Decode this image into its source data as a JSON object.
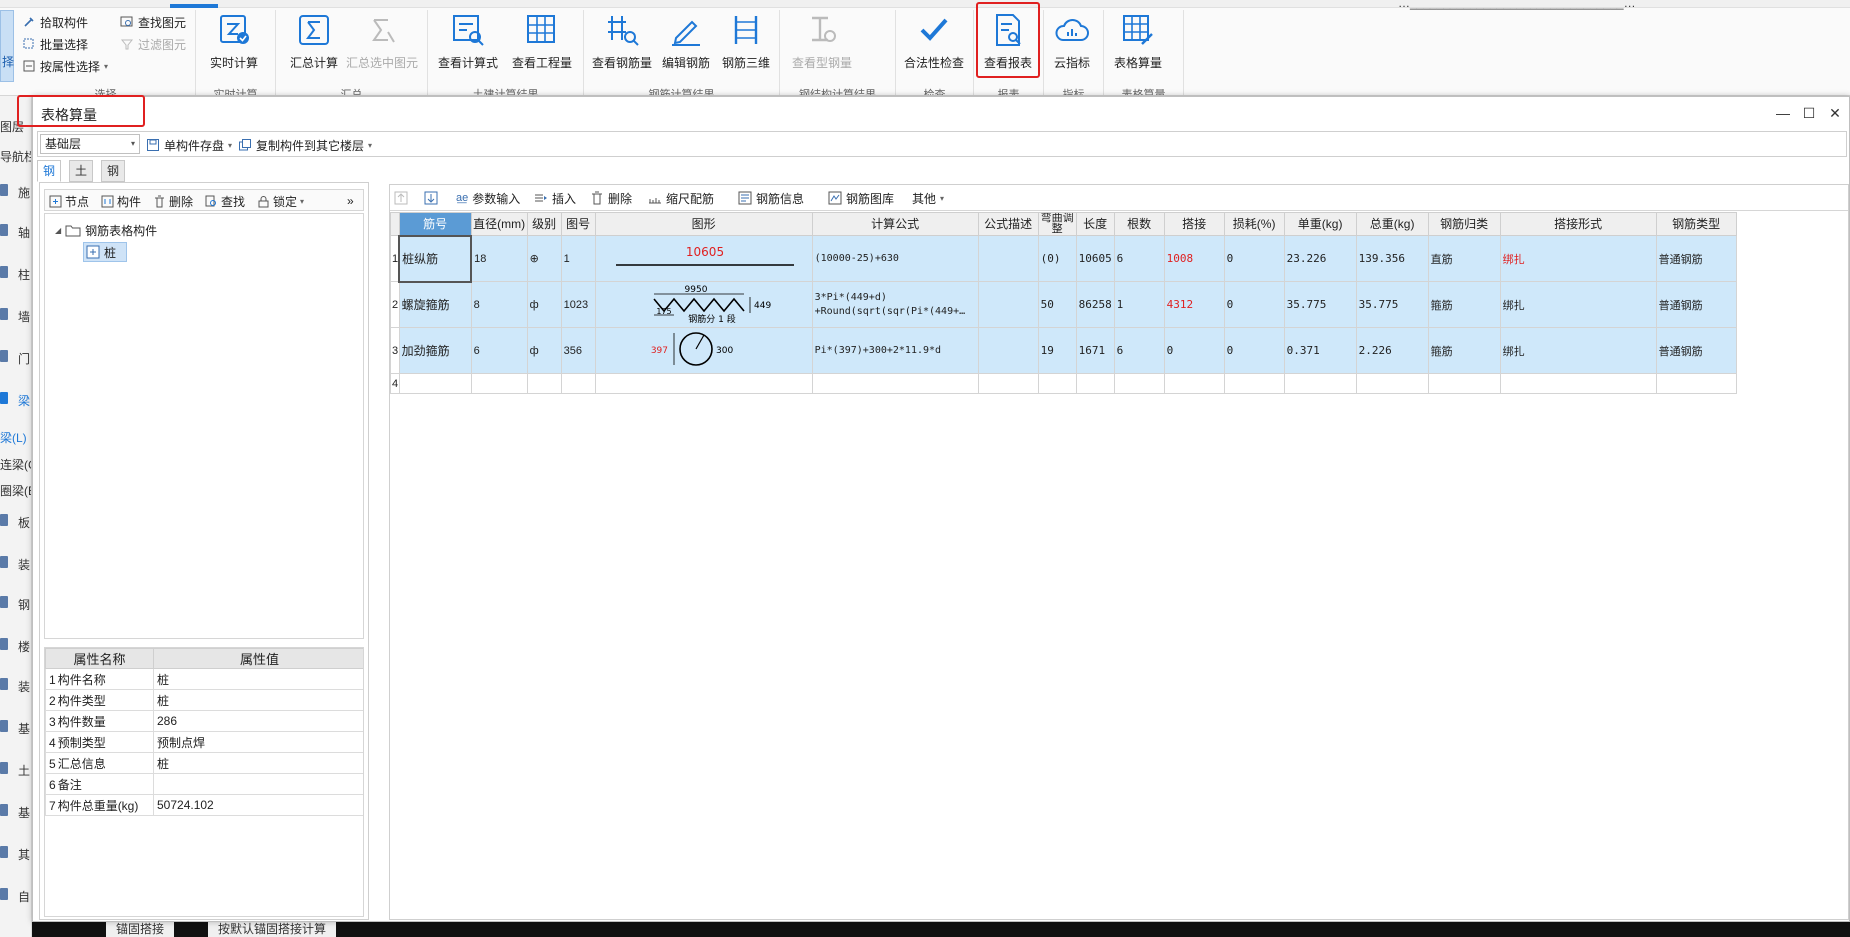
{
  "ribbon": {
    "title_fragment": "…________________________________…",
    "left_select_label": "择",
    "select_group": {
      "pick_label": "拾取构件",
      "batch_label": "批量选择",
      "attr_label": "按属性选择",
      "find_label": "查找图元",
      "filter_label": "过滤图元",
      "group_label": "选择"
    },
    "realtime_label": "实时计算",
    "realtime_group": "实时计算",
    "sum_label": "汇总计算",
    "sum_sel_label": "汇总选中图元",
    "sum_group": "汇总",
    "view_formula_label": "查看计算式",
    "view_qty_label": "查看工程量",
    "civil_group": "土建计算结果",
    "view_rebar_label": "查看钢筋量",
    "edit_rebar_label": "编辑钢筋",
    "rebar3d_label": "钢筋三维",
    "rebar_group": "钢筋计算结果",
    "view_steel_label": "查看型钢量",
    "steel_group": "钢结构计算结果",
    "check_label": "合法性检查",
    "check_group": "检查",
    "report_label": "查看报表",
    "report_group": "报表",
    "cloud_label": "云指标",
    "cloud_group": "指标",
    "table_calc_label": "表格算量",
    "table_calc_group": "表格算量"
  },
  "leftstrip": {
    "items": [
      "图层",
      "导航栏",
      "施",
      "轴",
      "柱",
      "墙",
      "门",
      "梁",
      "梁(L)",
      "连梁(G)",
      "圈梁(E)",
      "板",
      "装",
      "钢",
      "楼",
      "装",
      "基",
      "土",
      "基",
      "其",
      "自"
    ]
  },
  "bottom": {
    "tab1": "锚固搭接",
    "tab2": "按默认锚固搭接计算"
  },
  "dialog": {
    "title": "表格算量",
    "minimize": "—",
    "maximize": "☐",
    "close": "✕",
    "floor": "基础层",
    "save_label": "单构件存盘",
    "copy_label": "复制构件到其它楼层",
    "tabs": [
      "钢筋",
      "土建",
      "钢结构"
    ]
  },
  "tree_toolbar": {
    "node": "节点",
    "component": "构件",
    "delete": "删除",
    "find": "查找",
    "lock": "锁定",
    "more": "»"
  },
  "tree": {
    "root": "钢筋表格构件",
    "child": "桩"
  },
  "props": {
    "headers": [
      "属性名称",
      "属性值"
    ],
    "rows": [
      {
        "idx": "1",
        "name": "构件名称",
        "value": "桩"
      },
      {
        "idx": "2",
        "name": "构件类型",
        "value": "桩"
      },
      {
        "idx": "3",
        "name": "构件数量",
        "value": "286"
      },
      {
        "idx": "4",
        "name": "预制类型",
        "value": "预制点焊"
      },
      {
        "idx": "5",
        "name": "汇总信息",
        "value": "桩"
      },
      {
        "idx": "6",
        "name": "备注",
        "value": ""
      },
      {
        "idx": "7",
        "name": "构件总重量(kg)",
        "value": "50724.102"
      }
    ]
  },
  "grid_toolbar": {
    "param": "参数输入",
    "insert": "插入",
    "delete": "删除",
    "scale": "缩尺配筋",
    "info": "钢筋信息",
    "lib": "钢筋图库",
    "other": "其他"
  },
  "grid": {
    "headers": [
      "筋号",
      "直径(mm)",
      "级别",
      "图号",
      "图形",
      "计算公式",
      "公式描述",
      "弯曲调整",
      "长度",
      "根数",
      "搭接",
      "损耗(%)",
      "单重(kg)",
      "总重(kg)",
      "钢筋归类",
      "搭接形式",
      "钢筋类型"
    ],
    "rows": [
      {
        "idx": "1",
        "name": "桩纵筋",
        "dia": "18",
        "grade": "⊕",
        "fig": "1",
        "shape_label": "10605",
        "formula_1": "(10000-25)+630",
        "formula_2": "",
        "desc": "",
        "bend": "(0)",
        "length": "10605",
        "count": "6",
        "lap": "1008",
        "loss": "0",
        "unit_w": "23.226",
        "total_w": "139.356",
        "category": "直筋",
        "lap_type": "绑扎",
        "type": "普通钢筋"
      },
      {
        "idx": "2",
        "name": "螺旋箍筋",
        "dia": "8",
        "grade": "ф",
        "fig": "1023",
        "shape_top": "9950",
        "shape_right": "449",
        "shape_bottom_a": "175",
        "shape_bottom_b": "钢筋分 1 段",
        "formula_1": "3*Pi*(449+d)",
        "formula_2": "+Round(sqrt(sqr(Pi*(449+…",
        "desc": "",
        "bend": "50",
        "length": "86258",
        "count": "1",
        "lap": "4312",
        "loss": "0",
        "unit_w": "35.775",
        "total_w": "35.775",
        "category": "箍筋",
        "lap_type": "绑扎",
        "type": "普通钢筋"
      },
      {
        "idx": "3",
        "name": "加劲箍筋",
        "dia": "6",
        "grade": "ф",
        "fig": "356",
        "shape_left": "397",
        "shape_right": "300",
        "formula_1": "Pi*(397)+300+2*11.9*d",
        "formula_2": "",
        "desc": "",
        "bend": "19",
        "length": "1671",
        "count": "6",
        "lap": "0",
        "loss": "0",
        "unit_w": "0.371",
        "total_w": "2.226",
        "category": "箍筋",
        "lap_type": "绑扎",
        "type": "普通钢筋"
      }
    ],
    "empty_idx": "4"
  },
  "colors": {
    "accent": "#1e78d7",
    "highlight_red": "#e02020",
    "row_selected": "#cfe8fa",
    "header_active": "#5b9bd5"
  }
}
